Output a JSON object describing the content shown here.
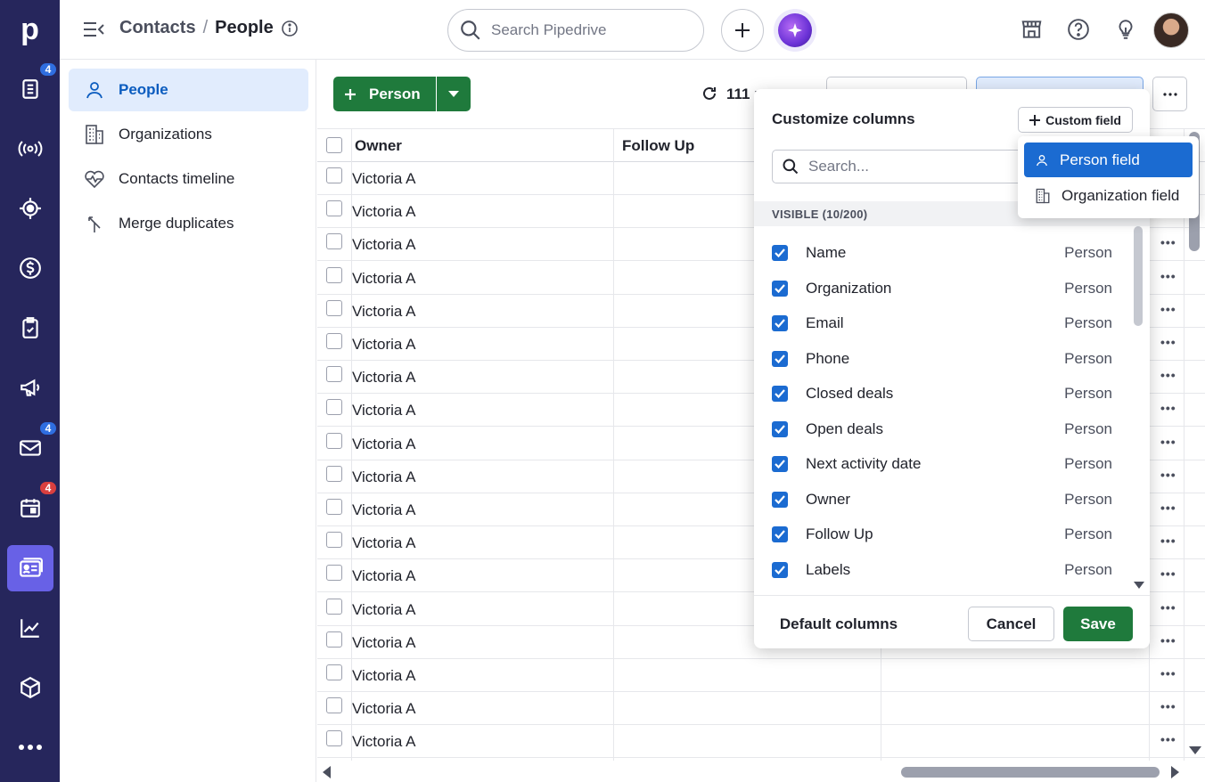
{
  "rail": {
    "logo": "p",
    "badges": {
      "deals": "4",
      "mail": "4",
      "calendar": "4"
    },
    "colors": {
      "bg": "#26265c",
      "active": "#6861e6",
      "badge_blue": "#2f6ee0",
      "badge_red": "#d93f3f"
    }
  },
  "topbar": {
    "breadcrumb_parent": "Contacts",
    "breadcrumb_sep": "/",
    "breadcrumb_current": "People",
    "search_placeholder": "Search Pipedrive"
  },
  "sidenav": {
    "items": [
      {
        "label": "People",
        "icon": "person-icon",
        "active": true
      },
      {
        "label": "Organizations",
        "icon": "building-icon"
      },
      {
        "label": "Contacts timeline",
        "icon": "heartbeat-icon"
      },
      {
        "label": "Merge duplicates",
        "icon": "merge-icon"
      }
    ]
  },
  "toolbar": {
    "add_label": "Person",
    "count_label": "111 p"
  },
  "table": {
    "headers": [
      "Owner",
      "Follow Up"
    ],
    "rows": [
      "Victoria A",
      "Victoria A",
      "Victoria A",
      "Victoria A",
      "Victoria A",
      "Victoria A",
      "Victoria A",
      "Victoria A",
      "Victoria A",
      "Victoria A",
      "Victoria A",
      "Victoria A",
      "Victoria A",
      "Victoria A",
      "Victoria A",
      "Victoria A",
      "Victoria A",
      "Victoria A"
    ],
    "row_menu": "•••"
  },
  "panel": {
    "title": "Customize columns",
    "custom_field_label": "Custom field",
    "search_placeholder": "Search...",
    "visible_header": "VISIBLE (10/200)",
    "fields": [
      {
        "name": "Name",
        "source": "Person"
      },
      {
        "name": "Organization",
        "source": "Person"
      },
      {
        "name": "Email",
        "source": "Person"
      },
      {
        "name": "Phone",
        "source": "Person"
      },
      {
        "name": "Closed deals",
        "source": "Person"
      },
      {
        "name": "Open deals",
        "source": "Person"
      },
      {
        "name": "Next activity date",
        "source": "Person"
      },
      {
        "name": "Owner",
        "source": "Person"
      },
      {
        "name": "Follow Up",
        "source": "Person"
      },
      {
        "name": "Labels",
        "source": "Person"
      }
    ],
    "default_columns_label": "Default columns",
    "cancel_label": "Cancel",
    "save_label": "Save"
  },
  "custom_field_menu": {
    "items": [
      {
        "label": "Person field",
        "icon": "person-icon",
        "selected": true
      },
      {
        "label": "Organization field",
        "icon": "building-icon"
      }
    ]
  }
}
